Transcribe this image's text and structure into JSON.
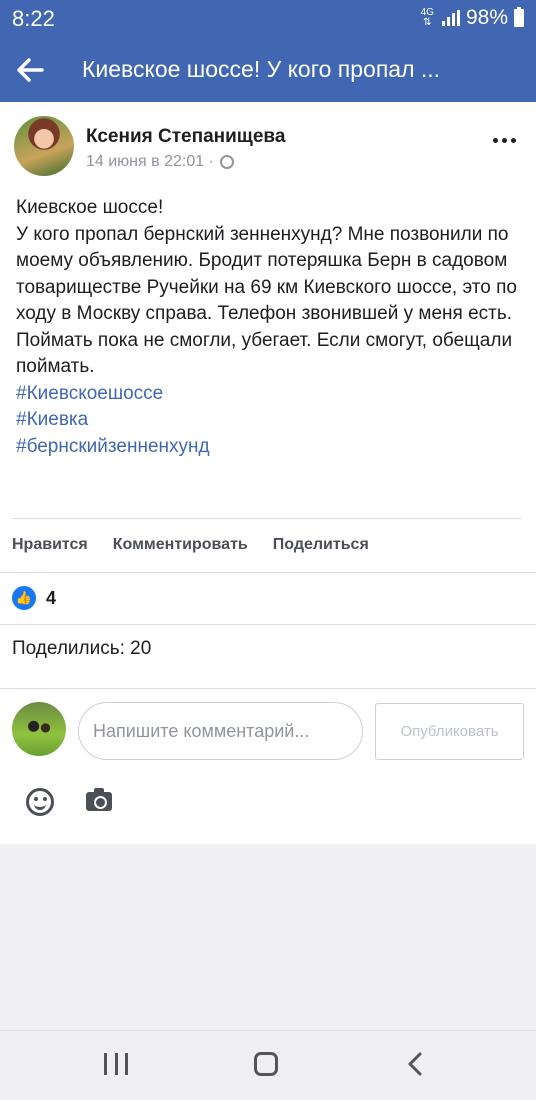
{
  "status_bar": {
    "time": "8:22",
    "network": "4G",
    "battery": "98%"
  },
  "header": {
    "title": "Киевское шоссе! У кого пропал ..."
  },
  "post": {
    "author": "Ксения Степанищева",
    "date": "14 июня в 22:01 ·",
    "lines": [
      "Киевское шоссе!",
      "У кого пропал бернский зенненхунд? Мне позвонили по моему объявлению. Бродит потеряшка Берн в садовом товариществе Ручейки на 69 км Киевского шоссе, это по ходу в Москву справа. Телефон звонившей у меня есть. Поймать пока не смогли, убегает. Если смогут, обещали поймать."
    ],
    "hashtags": [
      "#Киевскоешоссе",
      "#Киевка",
      "#бернскийзенненхунд"
    ]
  },
  "actions": {
    "like": "Нравится",
    "comment": "Комментировать",
    "share": "Поделиться"
  },
  "reactions": {
    "likes_count": "4",
    "shares_text": "Поделились: 20"
  },
  "comment_box": {
    "placeholder": "Напишите комментарий...",
    "publish": "Опубликовать"
  },
  "icons": {
    "back": "arrow-left-icon",
    "more": "more-icon",
    "privacy": "globe-icon",
    "like": "thumbs-up-icon",
    "emoji": "emoji-icon",
    "camera": "camera-icon"
  },
  "colors": {
    "brand": "#4267b2",
    "link": "#4267b2",
    "like_badge": "#1877f2"
  }
}
